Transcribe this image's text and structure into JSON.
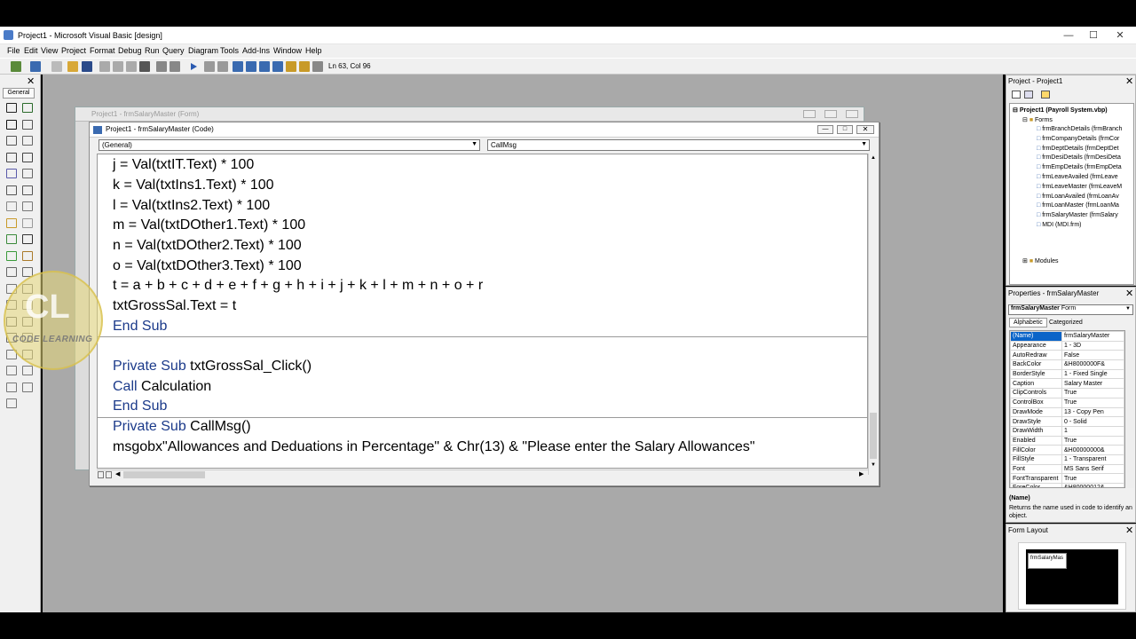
{
  "window": {
    "title": "Project1 - Microsoft Visual Basic [design]"
  },
  "menu": [
    "File",
    "Edit",
    "View",
    "Project",
    "Format",
    "Debug",
    "Run",
    "Query",
    "Diagram",
    "Tools",
    "Add-Ins",
    "Window",
    "Help"
  ],
  "status": {
    "position": "Ln 63, Col 96"
  },
  "toolbox": {
    "title": "General"
  },
  "form_window": {
    "title": "Project1 - frmSalaryMaster (Form)"
  },
  "code_window": {
    "title": "Project1 - frmSalaryMaster (Code)",
    "object_combo": "(General)",
    "proc_combo": "CallMsg",
    "lines": [
      "j = Val(txtIT.Text) * 100",
      "k = Val(txtIns1.Text) * 100",
      "l = Val(txtIns2.Text) * 100",
      "m = Val(txtDOther1.Text) * 100",
      "n = Val(txtDOther2.Text) * 100",
      "o = Val(txtDOther3.Text) * 100",
      "t = a + b + c + d + e + f + g + h + i + j + k + l + m + n + o + r",
      "txtGrossSal.Text = t",
      "End Sub",
      "",
      "Private Sub txtGrossSal_Click()",
      "Call Calculation",
      "End Sub",
      "Private Sub CallMsg()",
      "msgobx\"Allowances and Deduations in Percentage\" & Chr(13) & \"Please enter the Salary Allowances\""
    ]
  },
  "project": {
    "title": "Project - Project1",
    "root": "Project1 (Payroll System.vbp)",
    "forms_label": "Forms",
    "forms": [
      "frmBranchDetails (frmBranch",
      "frmCompanyDetails (frmCor",
      "frmDeptDetails (frmDeptDet",
      "frmDesiDetails (frmDesiDeta",
      "frmEmpDetails (frmEmpDeta",
      "frmLeaveAvailed (frmLeave",
      "frmLeaveMaster (frmLeaveM",
      "frmLoanAvailed (frmLoanAv",
      "frmLoanMaster (frmLoanMa",
      "frmSalaryMaster (frmSalary",
      "MDI (MDI.frm)"
    ],
    "modules_label": "Modules"
  },
  "properties": {
    "title": "Properties - frmSalaryMaster",
    "object": "frmSalaryMaster",
    "object_type": "Form",
    "tab_alpha": "Alphabetic",
    "tab_cat": "Categorized",
    "rows": [
      [
        "(Name)",
        "frmSalaryMaster"
      ],
      [
        "Appearance",
        "1 - 3D"
      ],
      [
        "AutoRedraw",
        "False"
      ],
      [
        "BackColor",
        "&H8000000F&"
      ],
      [
        "BorderStyle",
        "1 - Fixed Single"
      ],
      [
        "Caption",
        "Salary Master"
      ],
      [
        "ClipControls",
        "True"
      ],
      [
        "ControlBox",
        "True"
      ],
      [
        "DrawMode",
        "13 - Copy Pen"
      ],
      [
        "DrawStyle",
        "0 - Solid"
      ],
      [
        "DrawWidth",
        "1"
      ],
      [
        "Enabled",
        "True"
      ],
      [
        "FillColor",
        "&H00000000&"
      ],
      [
        "FillStyle",
        "1 - Transparent"
      ],
      [
        "Font",
        "MS Sans Serif"
      ],
      [
        "FontTransparent",
        "True"
      ],
      [
        "ForeColor",
        "&H80000012&"
      ]
    ],
    "desc_title": "(Name)",
    "desc_text": "Returns the name used in code to identify an object."
  },
  "form_layout": {
    "title": "Form Layout",
    "preview_label": "frmSalaryMas"
  },
  "logo": {
    "mark": "CL",
    "text": "CODE LEARNING"
  },
  "colors": {
    "keyword": "#1b3a8a",
    "mdi_bg": "#a9a9a9"
  }
}
